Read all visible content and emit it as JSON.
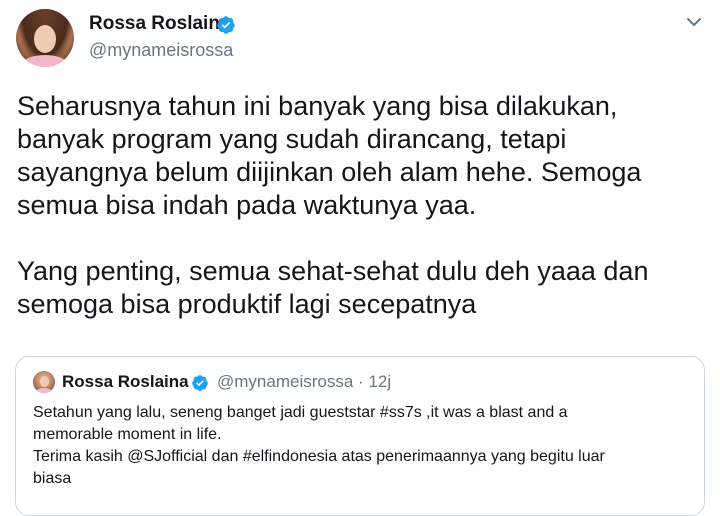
{
  "author": {
    "display_name": "Rossa Roslaina",
    "handle": "@mynameisrossa"
  },
  "icons": {
    "verified": "verified-badge-icon",
    "menu": "chevron-down-icon",
    "accent_color": "#1da1f2"
  },
  "tweet": {
    "text": "Seharusnya tahun ini banyak yang bisa dilakukan,\nbanyak program yang sudah dirancang, tetapi\nsayangnya belum diijinkan oleh alam hehe. Semoga\nsemua bisa indah pada waktunya yaa.\n\nYang penting, semua sehat-sehat dulu deh yaaa dan\nsemoga bisa produktif lagi secepatnya"
  },
  "quoted_tweet": {
    "display_name": "Rossa Roslaina",
    "handle": "@mynameisrossa",
    "separator": "·",
    "time": "12j",
    "text": "Setahun yang lalu, seneng banget jadi gueststar #ss7s ,it was a blast and a\nmemorable moment in life.\nTerima kasih @SJofficial dan #elfindonesia atas penerimaannya yang begitu luar\nbiasa"
  }
}
